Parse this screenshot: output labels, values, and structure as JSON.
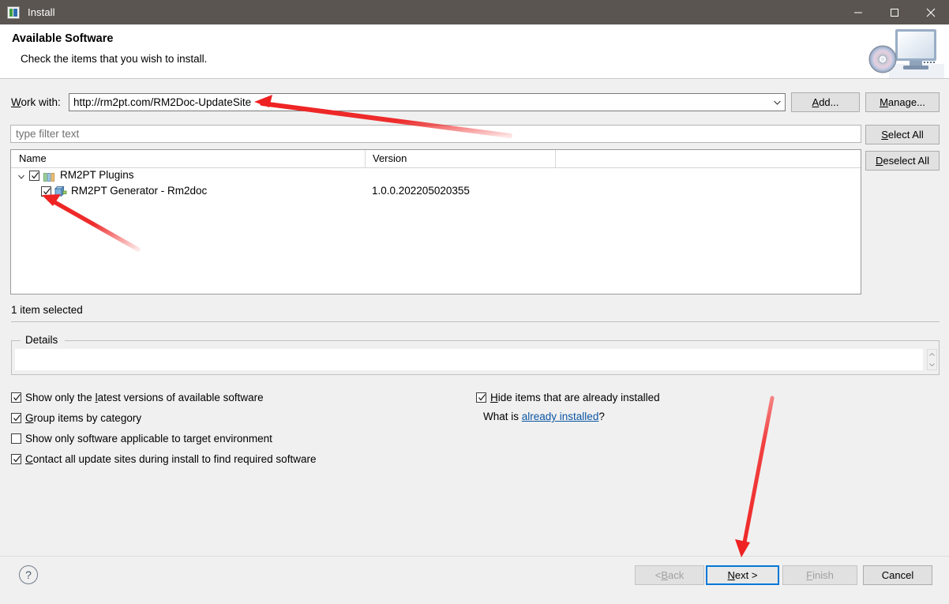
{
  "window": {
    "title": "Install",
    "icon": "install-plugin-icon",
    "controls": {
      "minimize": "minimize-icon",
      "maximize": "maximize-icon",
      "close": "close-icon"
    }
  },
  "header": {
    "title": "Available Software",
    "subtitle": "Check the items that you wish to install.",
    "art_icon": "cd-monitor-icon"
  },
  "work_with": {
    "label_pre": "W",
    "label_post": "ork with:",
    "value": "http://rm2pt.com/RM2Doc-UpdateSite",
    "dropdown_icon": "chevron-down-icon"
  },
  "buttons": {
    "add": {
      "mnemonic": "A",
      "rest": "dd..."
    },
    "manage": {
      "mnemonic": "M",
      "rest": "anage..."
    },
    "select_all": {
      "mnemonic": "S",
      "rest": "elect All"
    },
    "deselect_all": {
      "mnemonic": "D",
      "rest": "eselect All"
    }
  },
  "filter": {
    "placeholder": "type filter text",
    "value": ""
  },
  "tree": {
    "columns": [
      "Name",
      "Version"
    ],
    "rows": [
      {
        "name": "RM2PT Plugins",
        "version": "",
        "checked": true,
        "expanded": true,
        "level": 0,
        "icon": "category-bars-icon"
      },
      {
        "name": "RM2PT Generator - Rm2doc",
        "version": "1.0.0.202205020355",
        "checked": true,
        "level": 1,
        "icon": "plugin-icon"
      }
    ]
  },
  "status": {
    "selection": "1 item selected"
  },
  "details": {
    "group_title": "Details",
    "content": ""
  },
  "options": {
    "latest_versions": {
      "pre": "Show only the ",
      "mnemonic": "l",
      "post": "atest versions of available software",
      "checked": true
    },
    "group_by_category": {
      "pre": "",
      "mnemonic": "G",
      "post": "roup items by category",
      "checked": true
    },
    "applicable_target": {
      "pre": "",
      "mnemonic": "",
      "post": "Show only software applicable to target environment",
      "checked": false
    },
    "contact_all_sites": {
      "pre": "",
      "mnemonic": "C",
      "post": "ontact all update sites during install to find required software",
      "checked": true
    },
    "hide_installed": {
      "pre": "",
      "mnemonic": "H",
      "post": "ide items that are already installed",
      "checked": true
    },
    "what_is": {
      "prefix": "What is ",
      "link": "already installed",
      "suffix": "?"
    }
  },
  "footer": {
    "help": "?",
    "back": {
      "pre": "< ",
      "mnemonic": "B",
      "rest": "ack",
      "disabled": true
    },
    "next": {
      "pre": "",
      "mnemonic": "N",
      "rest": "ext >",
      "disabled": false,
      "focused": true
    },
    "finish": {
      "pre": "",
      "mnemonic": "F",
      "rest": "inish",
      "disabled": true
    },
    "cancel": {
      "pre": "",
      "mnemonic": "",
      "rest": "Cancel",
      "disabled": false
    }
  },
  "annotations": {
    "color": "#ee2222",
    "arrows": [
      {
        "name": "arrow-to-url-field",
        "target": "work-with-value"
      },
      {
        "name": "arrow-to-plugin-checkbox",
        "target": "tree-row-checkbox"
      },
      {
        "name": "arrow-to-next-button",
        "target": "next-button"
      }
    ]
  }
}
